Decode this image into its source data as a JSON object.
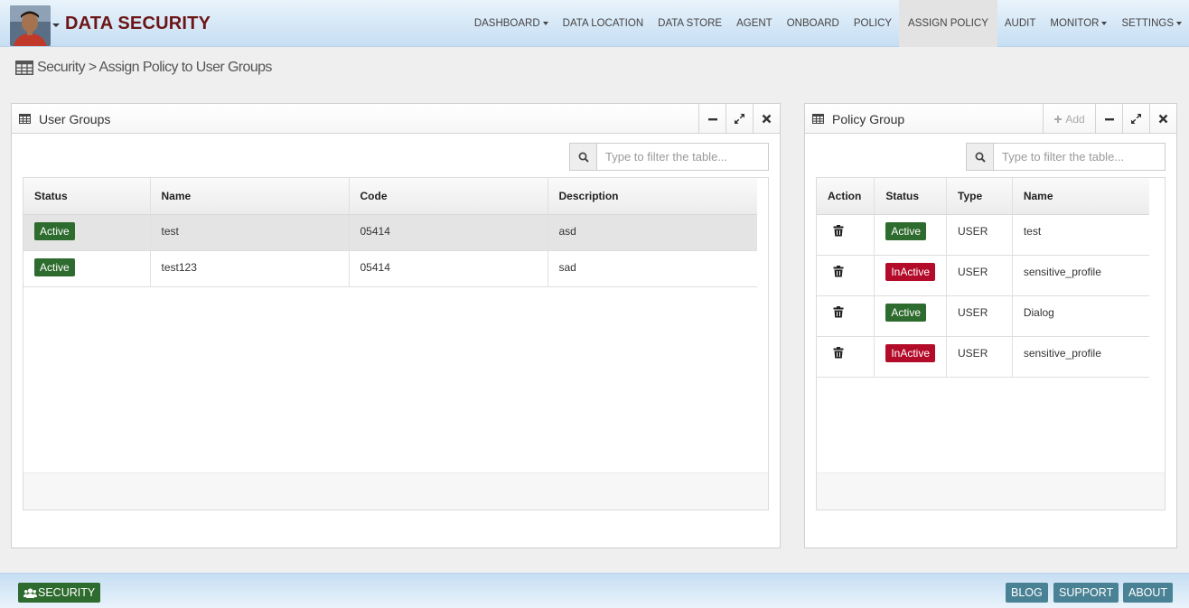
{
  "app": {
    "brand": "DATA SECURITY"
  },
  "nav": {
    "items": [
      {
        "label": "DASHBOARD",
        "dropdown": true
      },
      {
        "label": "DATA LOCATION",
        "dropdown": false
      },
      {
        "label": "DATA STORE",
        "dropdown": false
      },
      {
        "label": "AGENT",
        "dropdown": false
      },
      {
        "label": "ONBOARD",
        "dropdown": false
      },
      {
        "label": "POLICY",
        "dropdown": false
      },
      {
        "label": "ASSIGN POLICY",
        "dropdown": false,
        "active": true
      },
      {
        "label": "AUDIT",
        "dropdown": false
      },
      {
        "label": "MONITOR",
        "dropdown": true
      },
      {
        "label": "SETTINGS",
        "dropdown": true
      }
    ]
  },
  "breadcrumb": {
    "text": "Security > Assign Policy to User Groups"
  },
  "user_groups": {
    "title": "User Groups",
    "filter_placeholder": "Type to filter the table...",
    "columns": [
      "Status",
      "Name",
      "Code",
      "Description"
    ],
    "rows": [
      {
        "status": "Active",
        "name": "test",
        "code": "05414",
        "description": "asd"
      },
      {
        "status": "Active",
        "name": "test123",
        "code": "05414",
        "description": "sad"
      }
    ]
  },
  "policy_group": {
    "title": "Policy Group",
    "add_label": "Add",
    "filter_placeholder": "Type to filter the table...",
    "columns": [
      "Action",
      "Status",
      "Type",
      "Name"
    ],
    "rows": [
      {
        "status": "Active",
        "type": "USER",
        "name": "test"
      },
      {
        "status": "InActive",
        "type": "USER",
        "name": "sensitive_profile"
      },
      {
        "status": "Active",
        "type": "USER",
        "name": "Dialog"
      },
      {
        "status": "InActive",
        "type": "USER",
        "name": "sensitive_profile"
      }
    ]
  },
  "footer": {
    "security_label": "SECURITY",
    "blog_label": "BLOG",
    "support_label": "SUPPORT",
    "about_label": "ABOUT"
  },
  "colors": {
    "brand": "#6b1515",
    "active_badge": "#2e6b2e",
    "inactive_badge": "#b30c2a",
    "footer_button": "#4a8295"
  },
  "icons": [
    "user-avatar",
    "table-icon",
    "minus-icon",
    "expand-icon",
    "close-icon",
    "plus-icon",
    "search-icon",
    "trash-icon",
    "users-icon"
  ]
}
